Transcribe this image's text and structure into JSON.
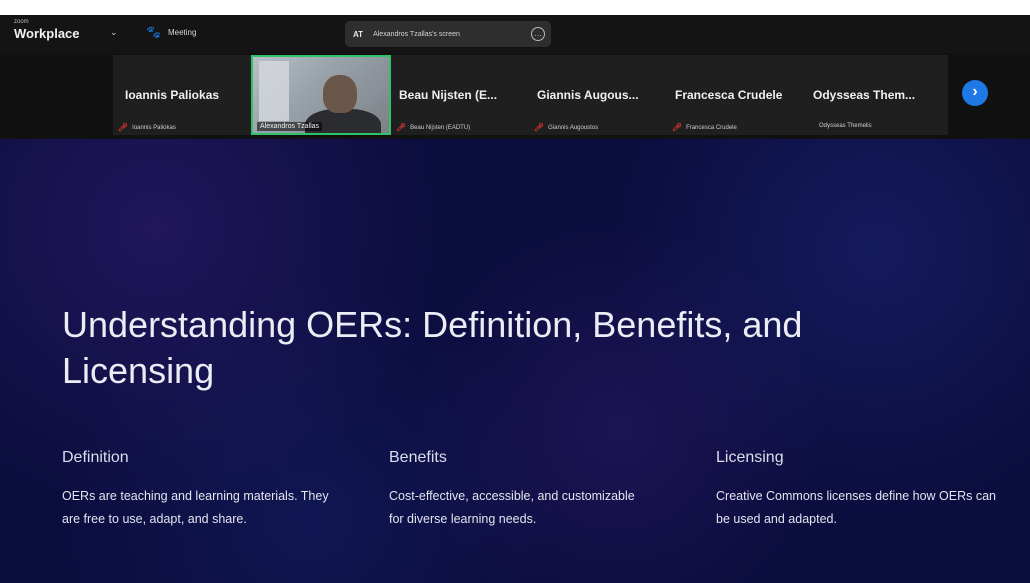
{
  "topbar": {
    "brand_small": "zoom",
    "brand": "Workplace",
    "chevron_icon": "chevron-down-icon",
    "meeting_label": "Meeting",
    "meeting_icon": "paw-icon",
    "share": {
      "initials": "AT",
      "text": "Alexandros Tzallas's screen",
      "options_icon": "more-options-icon"
    }
  },
  "participants": [
    {
      "name": "Ioannis Paliokas",
      "sub": "Ioannis Paliokas",
      "muted": true
    },
    {
      "video": true,
      "sub": "Alexandros Tzallas"
    },
    {
      "name": "Beau Nijsten (E...",
      "sub": "Beau Nijsten (EADTU)",
      "muted": true
    },
    {
      "name": "Giannis Augous...",
      "sub": "Giannis Augoustos",
      "muted": true
    },
    {
      "name": "Francesca Crudele",
      "sub": "Francesca Crudele",
      "muted": true
    },
    {
      "name": "Odysseas Them...",
      "sub": "Odysseas Themelis",
      "muted": false
    }
  ],
  "next_button_icon": "chevron-right-icon",
  "slide": {
    "title": "Understanding OERs: Definition, Benefits, and Licensing",
    "columns": [
      {
        "heading": "Definition",
        "body": "OERs are teaching and learning materials. They are free to use, adapt, and share."
      },
      {
        "heading": "Benefits",
        "body": "Cost-effective, accessible, and customizable for diverse learning needs."
      },
      {
        "heading": "Licensing",
        "body": "Creative Commons licenses define how OERs can be used and adapted."
      }
    ]
  }
}
